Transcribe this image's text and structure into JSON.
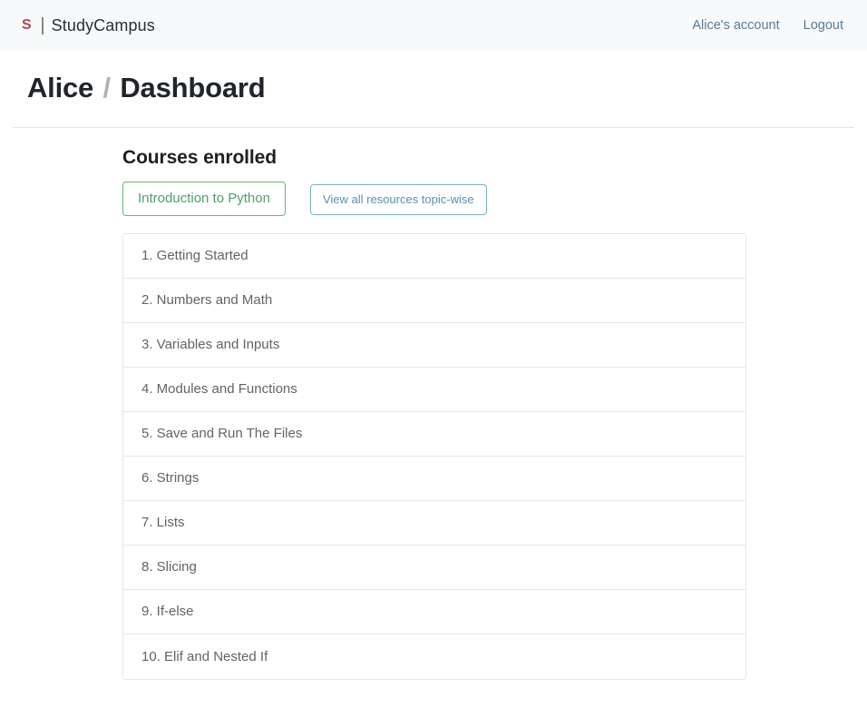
{
  "navbar": {
    "brand_mark": "S",
    "brand_name": "StudyCampus",
    "account_link": "Alice's account",
    "logout_link": "Logout",
    "background_color": "#f7f9fa",
    "brand_mark_color": "#b5454a",
    "link_color": "#5b7a94"
  },
  "page_header": {
    "user": "Alice",
    "separator": "/",
    "section": "Dashboard"
  },
  "main": {
    "section_title": "Courses enrolled",
    "buttons": [
      {
        "label": "Introduction to Python",
        "style": "outline-green",
        "color": "#4f9e69",
        "border_color": "#63b877"
      },
      {
        "label": "View all resources topic-wise",
        "style": "outline-blue",
        "color": "#5b8fa8",
        "border_color": "#7aafc4"
      }
    ],
    "topics": [
      {
        "label": "1. Getting Started"
      },
      {
        "label": "2. Numbers and Math"
      },
      {
        "label": "3. Variables and Inputs"
      },
      {
        "label": "4. Modules and Functions"
      },
      {
        "label": "5. Save and Run The Files"
      },
      {
        "label": "6. Strings"
      },
      {
        "label": "7. Lists"
      },
      {
        "label": "8. Slicing"
      },
      {
        "label": "9. If-else"
      },
      {
        "label": "10. Elif and Nested If"
      }
    ]
  }
}
